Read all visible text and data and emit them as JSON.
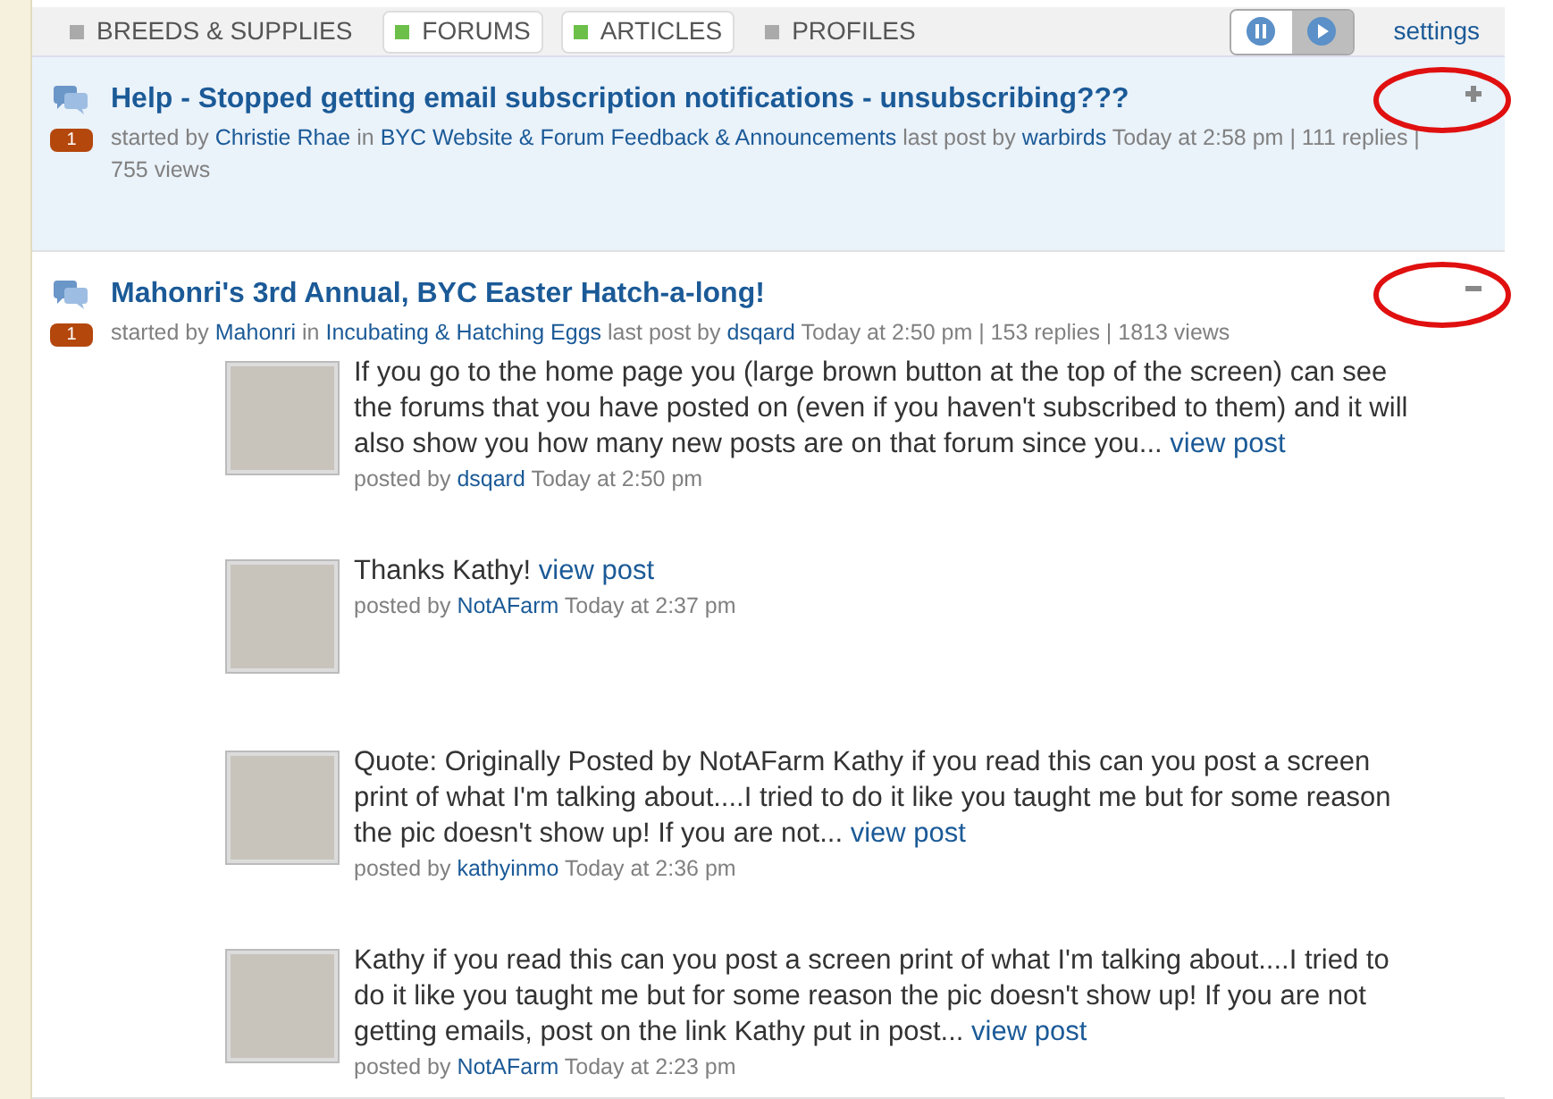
{
  "filters": [
    {
      "label": "BREEDS & SUPPLIES",
      "selected": false
    },
    {
      "label": "FORUMS",
      "selected": true
    },
    {
      "label": "ARTICLES",
      "selected": true
    },
    {
      "label": "PROFILES",
      "selected": false
    }
  ],
  "playback_buttons": [
    {
      "kind": "pause",
      "selected": true
    },
    {
      "kind": "play",
      "selected": false
    }
  ],
  "settings_link": "settings",
  "threads": [
    {
      "title": "Help - Stopped getting email subscription notifications - unsubscribing???",
      "badge": "1",
      "highlighted": true,
      "expanded": false,
      "circled": true,
      "meta": [
        {
          "kind": "text",
          "text": "started by"
        },
        {
          "kind": "link",
          "text": "Christie Rhae"
        },
        {
          "kind": "text",
          "text": "in"
        },
        {
          "kind": "link",
          "text": "BYC Website & Forum Feedback & Announcements"
        },
        {
          "kind": "text",
          "text": "last post by"
        },
        {
          "kind": "link",
          "text": "warbirds"
        },
        {
          "kind": "text",
          "text": "Today at 2:58 pm | 111 replies | 755 views"
        }
      ]
    },
    {
      "title": "Mahonri's 3rd Annual, BYC Easter Hatch-a-long!",
      "badge": "1",
      "highlighted": false,
      "expanded": true,
      "circled": true,
      "meta": [
        {
          "kind": "text",
          "text": "started by"
        },
        {
          "kind": "link",
          "text": "Mahonri"
        },
        {
          "kind": "text",
          "text": "in"
        },
        {
          "kind": "link",
          "text": "Incubating & Hatching Eggs"
        },
        {
          "kind": "text",
          "text": "last post by"
        },
        {
          "kind": "link",
          "text": "dsqard"
        },
        {
          "kind": "text",
          "text": "Today at 2:50 pm | 153 replies | 1813 views"
        }
      ],
      "posts": [
        {
          "text": "If  you go to the home page you (large brown button at the top of the screen) can see the forums that you have posted on (even if you haven't subscribed to them) and it will also show you how many new posts are on that forum since you...",
          "link": "view post",
          "posted_by": "posted by",
          "user": "dsqard",
          "time": "Today at 2:50 pm"
        },
        {
          "text": "Thanks Kathy!",
          "link": "view post",
          "posted_by": "posted by",
          "user": "NotAFarm",
          "time": "Today at 2:37 pm"
        },
        {
          "text": "Quote: Originally Posted by NotAFarm  Kathy if you read this can you post a screen print of what I'm talking about....I tried to do it like you taught me but for some reason the pic doesn't show up!   If you are not...",
          "link": "view post",
          "posted_by": "posted by",
          "user": "kathyinmo",
          "time": "Today at 2:36 pm"
        },
        {
          "text": "Kathy if you read this can you post a screen print of what I'm talking about....I tried to do it like you taught me but for some reason the pic doesn't show up!   If you are not getting emails, post on the link Kathy put in post...",
          "link": "view post",
          "posted_by": "posted by",
          "user": "NotAFarm",
          "time": "Today at 2:23 pm"
        }
      ]
    }
  ]
}
